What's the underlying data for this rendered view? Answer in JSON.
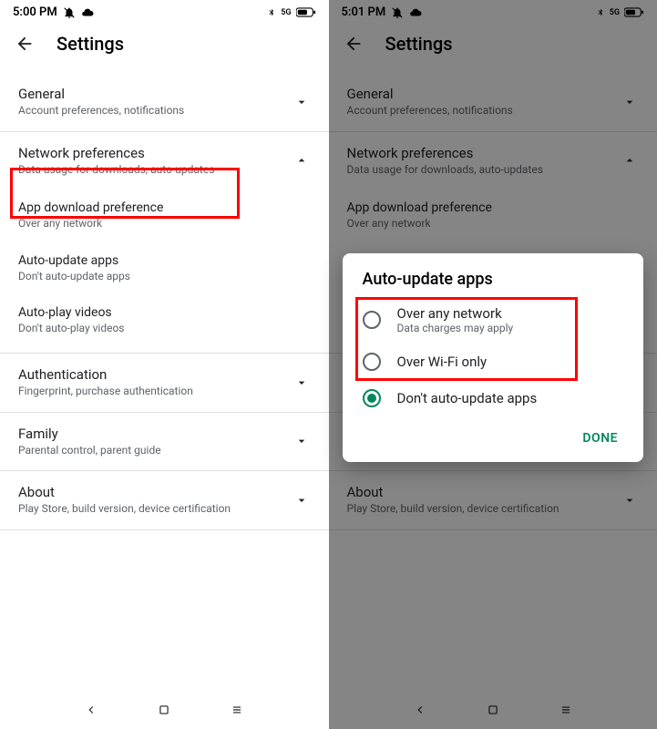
{
  "left": {
    "time": "5:00 PM",
    "signal": "5G",
    "title": "Settings",
    "sections": {
      "general": {
        "title": "General",
        "sub": "Account preferences, notifications"
      },
      "network": {
        "title": "Network preferences",
        "sub": "Data usage for downloads, auto-updates"
      },
      "download_pref": {
        "title": "App download preference",
        "sub": "Over any network"
      },
      "auto_update": {
        "title": "Auto-update apps",
        "sub": "Don't auto-update apps"
      },
      "auto_play": {
        "title": "Auto-play videos",
        "sub": "Don't auto-play videos"
      },
      "auth": {
        "title": "Authentication",
        "sub": "Fingerprint, purchase authentication"
      },
      "family": {
        "title": "Family",
        "sub": "Parental control, parent guide"
      },
      "about": {
        "title": "About",
        "sub": "Play Store, build version, device certification"
      }
    }
  },
  "right": {
    "time": "5:01 PM",
    "signal": "5G",
    "title": "Settings",
    "dialog": {
      "title": "Auto-update apps",
      "opt1": {
        "label": "Over any network",
        "sub": "Data charges may apply"
      },
      "opt2": {
        "label": "Over Wi-Fi only"
      },
      "opt3": {
        "label": "Don't auto-update apps"
      },
      "done": "DONE"
    }
  }
}
